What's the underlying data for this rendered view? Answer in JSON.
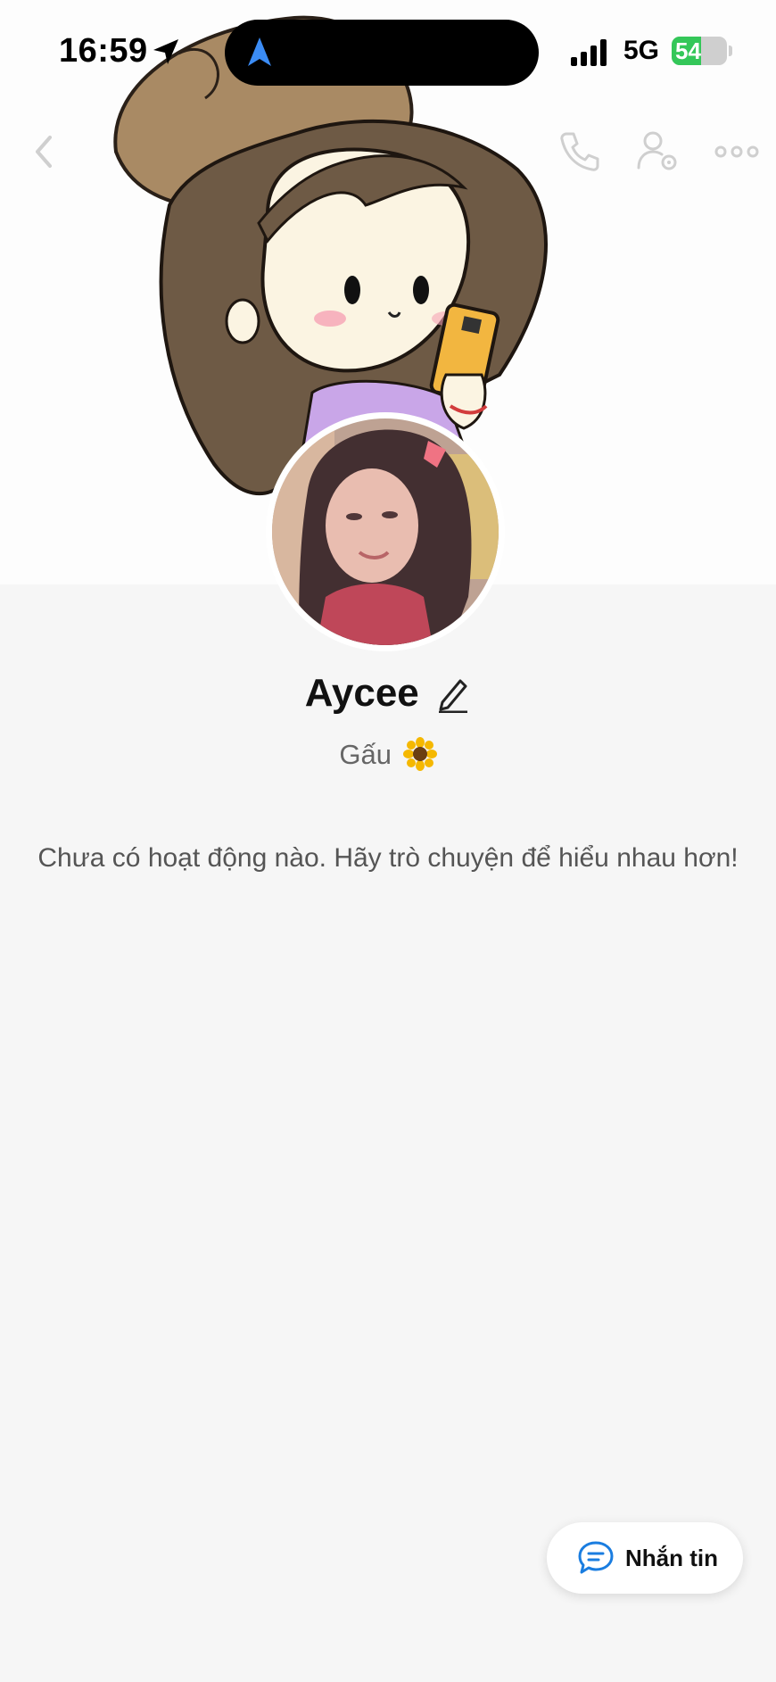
{
  "status_bar": {
    "time": "16:59",
    "network": "5G",
    "battery": "54",
    "battery_level": 0.54
  },
  "profile": {
    "name": "Aycee",
    "bio": "Gấu",
    "bio_emoji_icon": "sunflower-icon"
  },
  "activity": {
    "empty_message": "Chưa có hoạt động nào. Hãy trò chuyện để hiểu nhau hơn!"
  },
  "actions": {
    "message_label": "Nhắn tin"
  },
  "icons": {
    "back": "chevron-left-icon",
    "call": "phone-icon",
    "settings": "user-settings-icon",
    "more": "more-dots-icon",
    "edit": "pencil-icon",
    "message": "chat-bubble-icon"
  },
  "colors": {
    "accent": "#1a7de0",
    "battery": "#34c759",
    "background": "#f6f6f6"
  }
}
